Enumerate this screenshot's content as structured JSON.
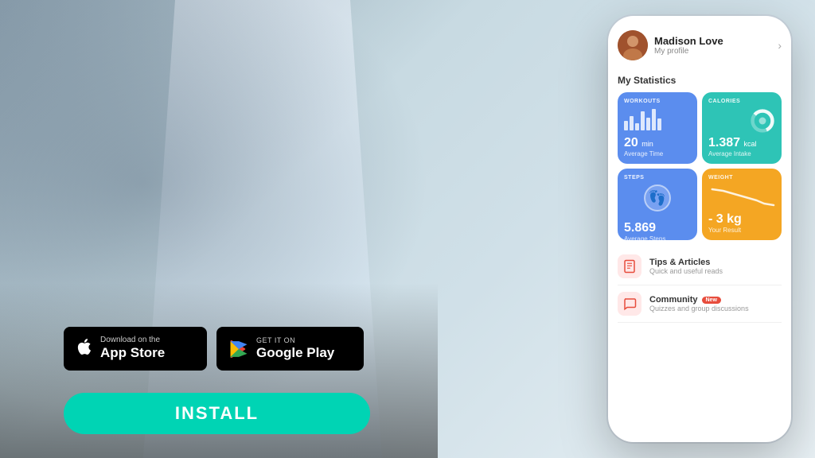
{
  "background": {
    "color_left": "#a8bcc8",
    "color_right": "#dce8ef"
  },
  "store_buttons": {
    "app_store": {
      "small_text": "Download on the",
      "big_text": "App Store",
      "icon": "apple"
    },
    "google_play": {
      "small_text": "GET IT ON",
      "big_text": "Google Play",
      "icon": "play"
    }
  },
  "install_button": {
    "label": "INSTALL"
  },
  "phone": {
    "profile": {
      "name": "Madison Love",
      "subtitle": "My profile"
    },
    "stats_title": "My Statistics",
    "stats": [
      {
        "id": "workouts",
        "label": "WORKOUTS",
        "value": "20",
        "unit": "min",
        "desc": "Average Time",
        "type": "bar",
        "color": "#5b8dee",
        "bars": [
          40,
          55,
          30,
          70,
          50,
          80,
          45
        ]
      },
      {
        "id": "calories",
        "label": "CALORIES",
        "value": "1.387",
        "unit": "kcal",
        "desc": "Average Intake",
        "type": "donut",
        "color": "#2ec4b6",
        "percent": 72
      },
      {
        "id": "steps",
        "label": "STEPS",
        "value": "5.869",
        "unit": "",
        "desc": "Average Steps",
        "type": "steps",
        "color": "#5b8dee"
      },
      {
        "id": "weight",
        "label": "WEIGHT",
        "value": "- 3 kg",
        "unit": "",
        "desc": "Your Result",
        "type": "line",
        "color": "#f4a623"
      }
    ],
    "menu_items": [
      {
        "id": "tips",
        "icon": "📄",
        "icon_color": "#ffe0e0",
        "title": "Tips & Articles",
        "subtitle": "Quick and useful reads",
        "badge": null
      },
      {
        "id": "community",
        "icon": "💬",
        "icon_color": "#ffe0e0",
        "title": "Community",
        "subtitle": "Quizzes and group discussions",
        "badge": "New"
      }
    ]
  }
}
